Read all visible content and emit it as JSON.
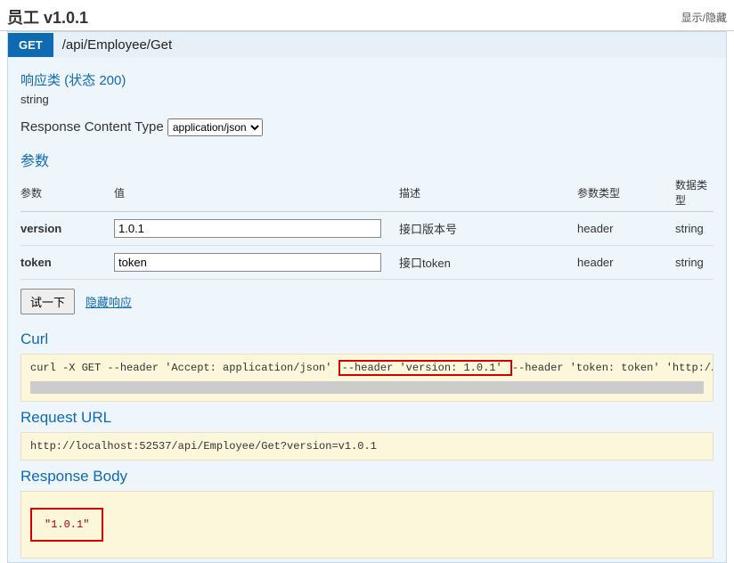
{
  "header": {
    "title": "员工 v1.0.1",
    "toggle": "显示/隐藏"
  },
  "operation": {
    "method": "GET",
    "path": "/api/Employee/Get",
    "responseClassTitle": "响应类 (状态 200)",
    "responseType": "string",
    "contentTypeLabel": "Response Content Type",
    "contentTypeValue": "application/json",
    "paramsTitle": "参数",
    "paramsHeader": {
      "name": "参数",
      "value": "值",
      "desc": "描述",
      "paramType": "参数类型",
      "dataType": "数据类型"
    },
    "params": [
      {
        "name": "version",
        "value": "1.0.1",
        "desc": "接口版本号",
        "paramType": "header",
        "dataType": "string"
      },
      {
        "name": "token",
        "value": "token",
        "desc": "接口token",
        "paramType": "header",
        "dataType": "string"
      }
    ],
    "tryBtn": "试一下",
    "hideLink": "隐藏响应"
  },
  "results": {
    "curlTitle": "Curl",
    "curl_pre": "curl -X GET --header 'Accept: application/json' ",
    "curl_hl": "--header 'version: 1.0.1' ",
    "curl_post": "--header 'token: token' 'http://localh",
    "requestUrlTitle": "Request URL",
    "requestUrl": "http://localhost:52537/api/Employee/Get?version=v1.0.1",
    "responseBodyTitle": "Response Body",
    "responseBody": "\"1.0.1\""
  }
}
